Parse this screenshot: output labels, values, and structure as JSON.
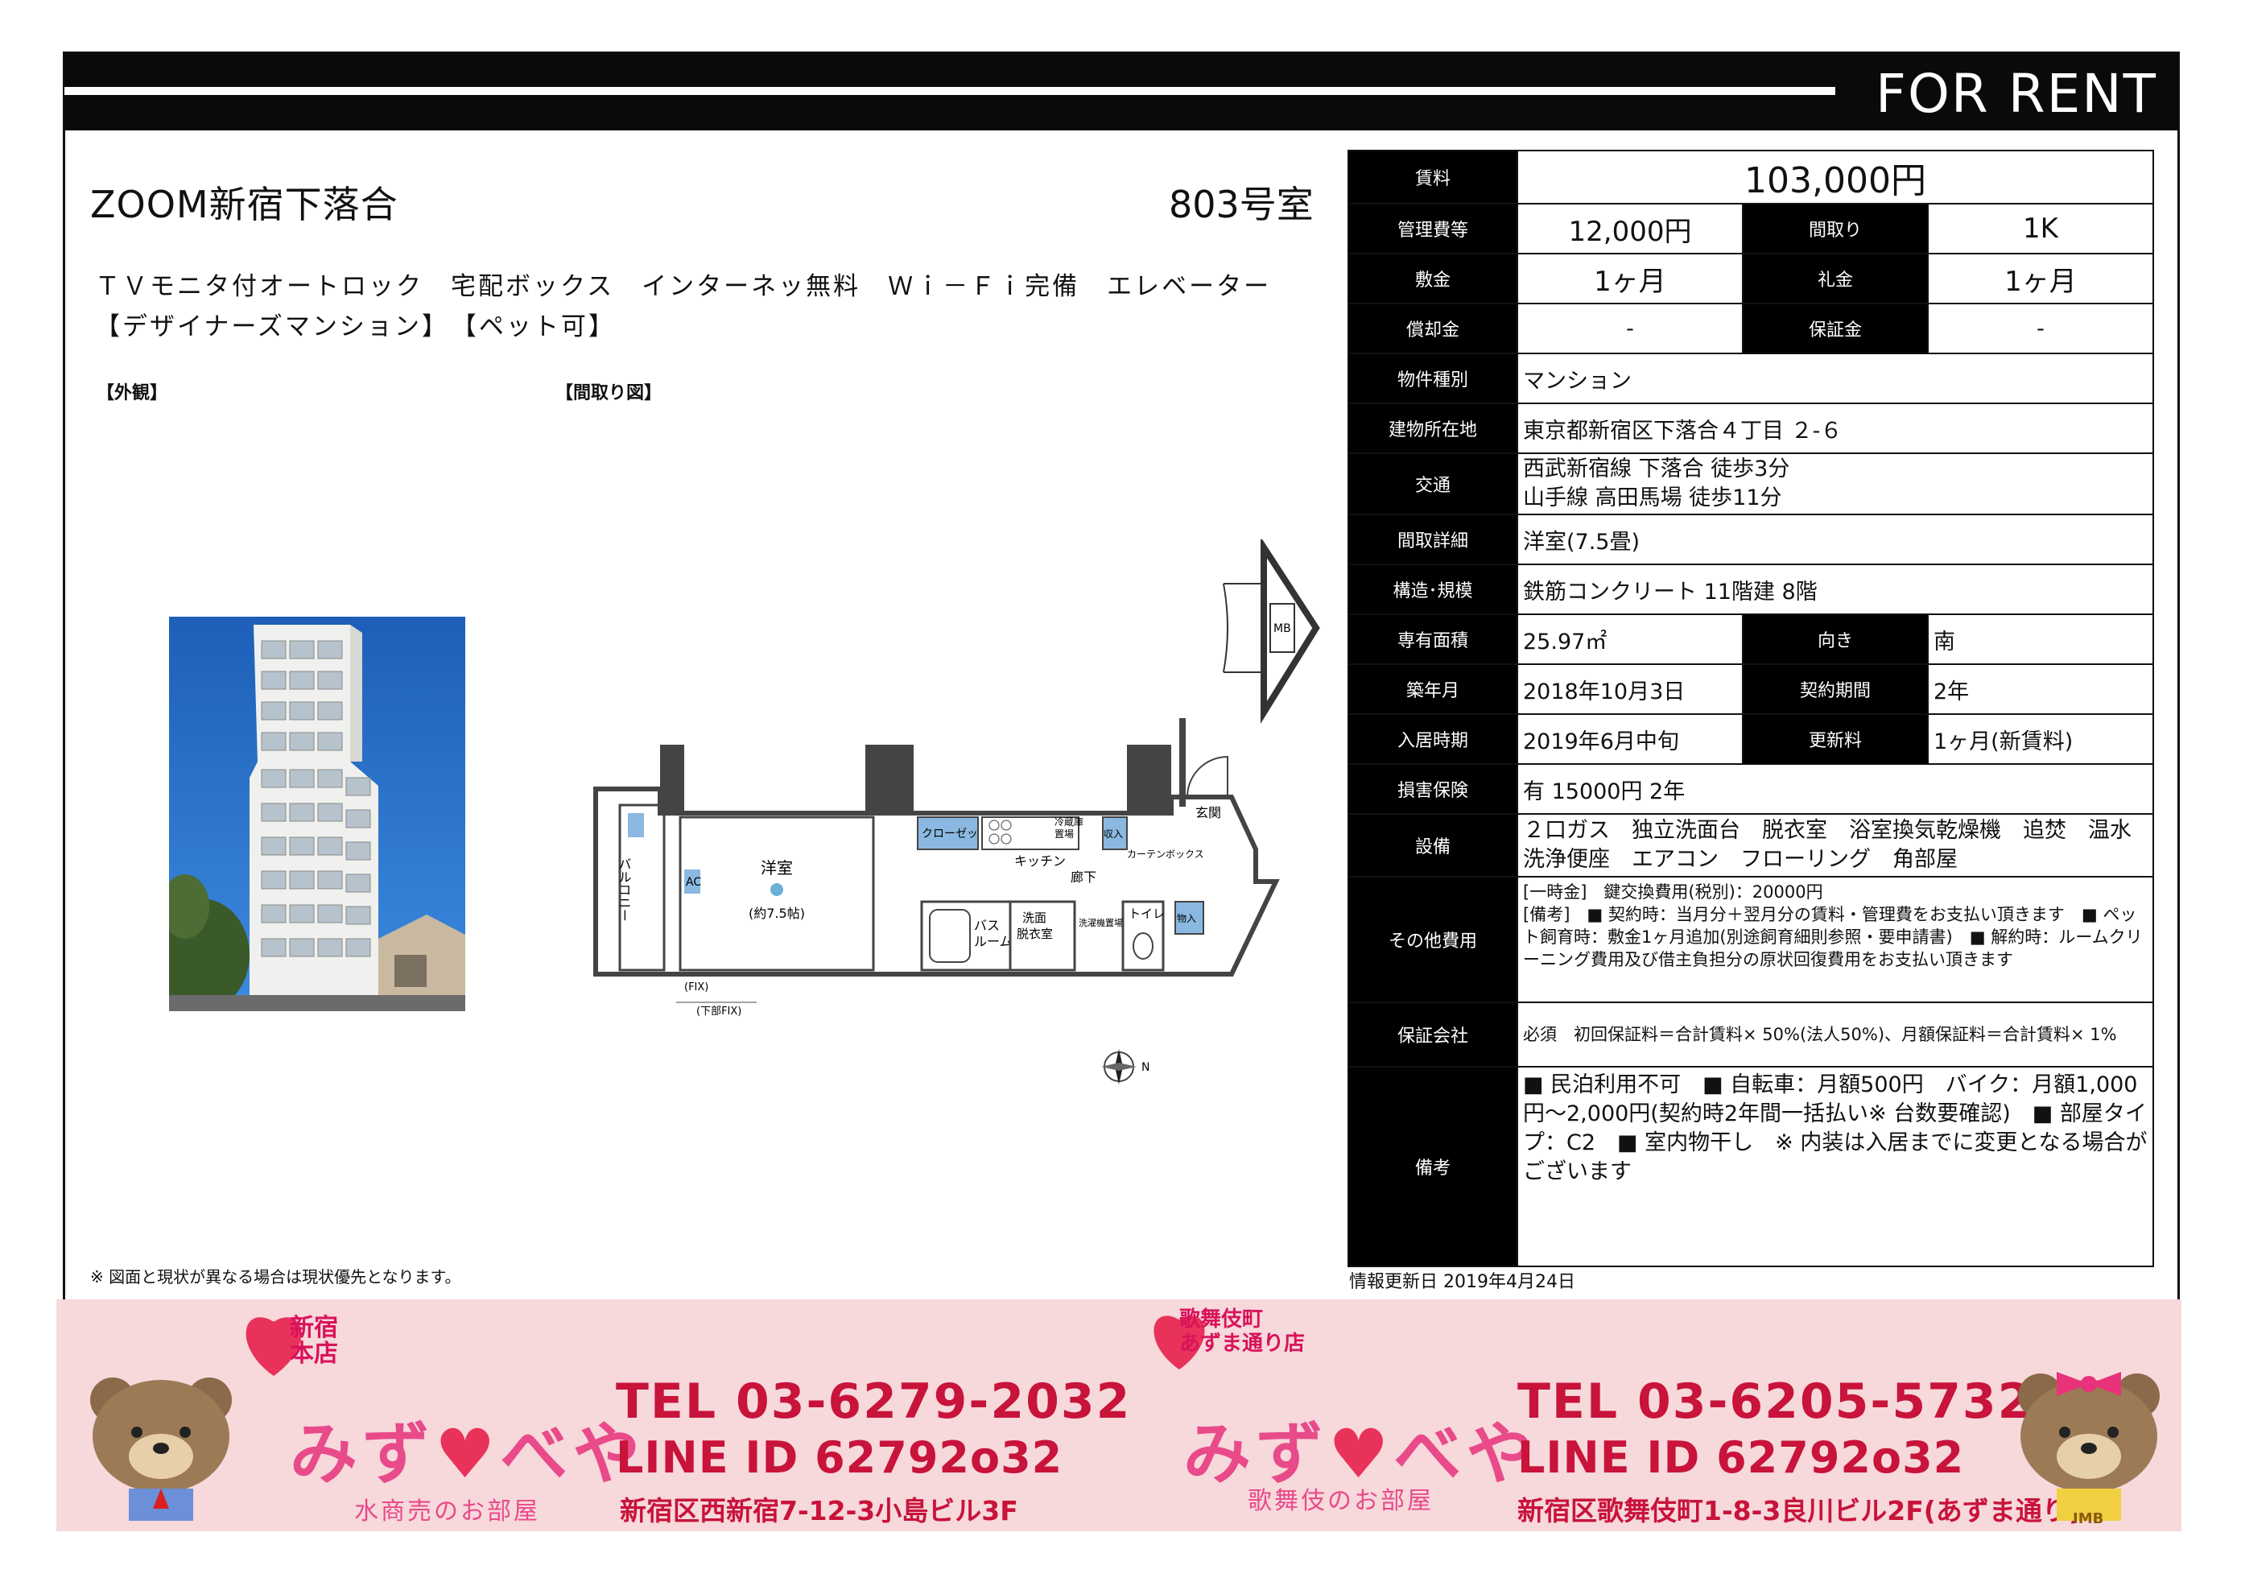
{
  "header": {
    "for_rent": "FOR RENT"
  },
  "property": {
    "name": "ZOOM新宿下落合",
    "room": "803号室",
    "features_line1": "ＴＶモニタ付オートロック　宅配ボックス　インターネッ無料　Ｗｉ－Ｆｉ完備　エレベーター",
    "features_line2": "【デザイナーズマンション】　【ペット可】",
    "exterior_label": "【外観】",
    "floorplan_label": "【間取り図】",
    "notice": "※ 図面と現状が異なる場合は現状優先となります。"
  },
  "floorplan": {
    "western_room": "洋室",
    "western_size": "(約7.5帖)",
    "closet": "クローゼット",
    "kitchen": "キッチン",
    "hallway": "廊下",
    "entrance": "玄関",
    "bath": "バス",
    "bath2": "ルーム",
    "washroom": "洗面",
    "washroom2": "脱衣室",
    "toilet": "トイレ",
    "fridge": "冷蔵庫",
    "fridge2": "置場",
    "storage": "収入",
    "storage2": "物入",
    "balcony_v": "バルコニー",
    "curtain_box": "カーテンボックス",
    "ac": "AC",
    "mb": "MB",
    "fix": "(FIX)",
    "fix_lower": "(下部FIX)",
    "washer": "洗濯機置場",
    "compass": "N"
  },
  "info": {
    "rent_label": "賃料",
    "rent": "103,000円",
    "mgmt_label": "管理費等",
    "mgmt": "12,000円",
    "layout_label": "間取り",
    "layout": "1K",
    "deposit_label": "敷金",
    "deposit": "1ヶ月",
    "key_money_label": "礼金",
    "key_money": "1ヶ月",
    "amortization_label": "償却金",
    "amortization": "-",
    "guarantee_label": "保証金",
    "guarantee": "-",
    "type_label": "物件種別",
    "type": "マンション",
    "address_label": "建物所在地",
    "address": "東京都新宿区下落合４丁目 ２-６",
    "transport_label": "交通",
    "transport1": "西武新宿線 下落合 徒歩3分",
    "transport2": "山手線 高田馬場 徒歩11分",
    "layout_detail_label": "間取詳細",
    "layout_detail": "洋室(7.5畳)",
    "structure_label": "構造･規模",
    "structure": "鉄筋コンクリート 11階建 8階",
    "area_label": "専有面積",
    "area": "25.97㎡",
    "direction_label": "向き",
    "direction": "南",
    "built_label": "築年月",
    "built": "2018年10月3日",
    "contract_label": "契約期間",
    "contract": "2年",
    "movein_label": "入居時期",
    "movein": "2019年6月中旬",
    "renewal_label": "更新料",
    "renewal": "1ヶ月(新賃料)",
    "insurance_label": "損害保険",
    "insurance": "有  15000円 2年",
    "equipment_label": "設備",
    "equipment": "２口ガス　独立洗面台　脱衣室　浴室換気乾燥機　追焚　温水洗浄便座　エアコン　フローリング　角部屋",
    "other_label": "その他費用",
    "other1": "[一時金]　鍵交換費用(税別)：20000円",
    "other2": "[備考]　■ 契約時：当月分＋翌月分の賃料・管理費をお支払い頂きます　■ ペット飼育時：敷金1ヶ月追加(別途飼育細則参照・要申請書)　■ 解約時：ルームクリーニング費用及び借主負担分の原状回復費用をお支払い頂きます",
    "guarantor_label": "保証会社",
    "guarantor": "必須　初回保証料＝合計賃料× 50%(法人50%)、月額保証料＝合計賃料× 1%",
    "remarks_label": "備考",
    "remarks": "■ 民泊利用不可　■ 自転車：月額500円　バイク：月額1,000円～2,000円(契約時2年間一括払い※ 台数要確認)　■ 部屋タイプ：C2　■ 室内物干し　※ 内装は入居までに変更となる場合がございます"
  },
  "updated": "情報更新日 2019年4月24日",
  "banner": {
    "store1_tag1": "新宿",
    "store1_tag2": "本店",
    "store1_brand": "みず",
    "store1_brand2": "べや",
    "store1_sub": "水商売のお部屋",
    "store1_tel": "TEL 03-6279-2032",
    "store1_line": "LINE ID 62792o32",
    "store1_addr": "新宿区西新宿7-12-3小島ビル3F",
    "store2_tag1": "歌舞伎町",
    "store2_tag2": "あずま通り店",
    "store2_brand": "みず",
    "store2_brand2": "べや",
    "store2_sub": "歌舞伎のお部屋",
    "store2_tel": "TEL 03-6205-5732",
    "store2_line": "LINE ID 62792o32",
    "store2_addr": "新宿区歌舞伎町1-8-3良川ビル2F(あずま通り)",
    "bear_badge": "IMB"
  },
  "colors": {
    "accent": "#c8133a",
    "brand_pink": "#e84a8a",
    "banner_bg": "#f7d8db"
  }
}
